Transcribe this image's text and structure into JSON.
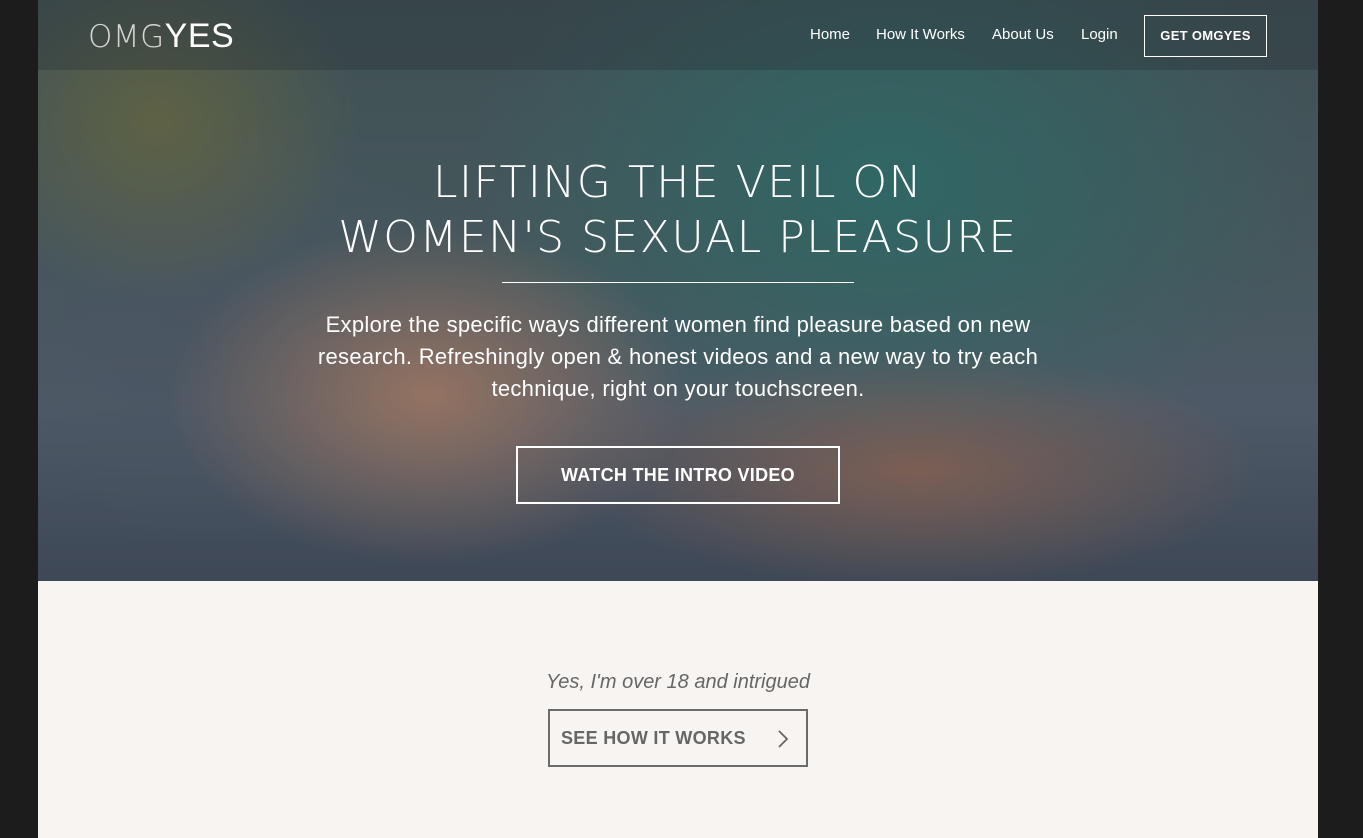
{
  "nav": {
    "logo_part1": "OMG",
    "logo_part2": "YES",
    "links": [
      "Home",
      "How It Works",
      "About Us",
      "Login"
    ],
    "cta": "GET OMGYES"
  },
  "hero": {
    "headline_line1": "LIFTING THE VEIL ON",
    "headline_line2": "WOMEN'S SEXUAL PLEASURE",
    "subtext": "Explore the specific ways different women find pleasure based on new research. Refreshingly open & honest videos and a new way to try each technique, right on your touchscreen.",
    "video_button": "WATCH THE INTRO VIDEO"
  },
  "age_gate": {
    "prompt": "Yes, I'm over 18 and intrigued",
    "button": "SEE HOW IT WORKS",
    "button_icon": "chevron-right-icon"
  }
}
